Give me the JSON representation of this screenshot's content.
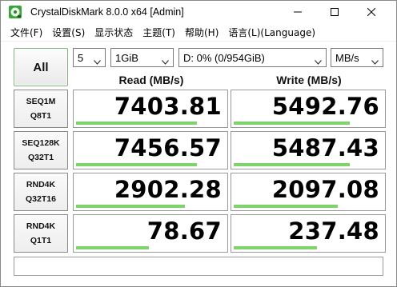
{
  "window": {
    "title": "CrystalDiskMark 8.0.0 x64 [Admin]"
  },
  "menu": [
    {
      "label": "文件(F)"
    },
    {
      "label": "设置(S)"
    },
    {
      "label": "显示状态"
    },
    {
      "label": "主题(T)"
    },
    {
      "label": "帮助(H)"
    },
    {
      "label": "语言(L)(Language)"
    }
  ],
  "controls": {
    "all_label": "All",
    "count": "5",
    "size": "1GiB",
    "drive": "D: 0% (0/954GiB)",
    "unit": "MB/s"
  },
  "columns": {
    "read": "Read (MB/s)",
    "write": "Write (MB/s)"
  },
  "results": [
    {
      "line1": "SEQ1M",
      "line2": "Q8T1",
      "read": "7403.81",
      "write": "5492.76",
      "read_bar": 0.81,
      "write_bar": 0.78
    },
    {
      "line1": "SEQ128K",
      "line2": "Q32T1",
      "read": "7456.57",
      "write": "5487.43",
      "read_bar": 0.81,
      "write_bar": 0.78
    },
    {
      "line1": "RND4K",
      "line2": "Q32T16",
      "read": "2902.28",
      "write": "2097.08",
      "read_bar": 0.73,
      "write_bar": 0.7
    },
    {
      "line1": "RND4K",
      "line2": "Q1T1",
      "read": "78.67",
      "write": "237.48",
      "read_bar": 0.49,
      "write_bar": 0.56
    }
  ],
  "status_text": "",
  "colors": {
    "bar_fill": "#7ed36a",
    "all_border": "#7fb27f"
  },
  "icons": {
    "app": "crystaldiskmark-icon",
    "minimize": "minimize-icon",
    "maximize": "maximize-icon",
    "close": "close-icon"
  }
}
